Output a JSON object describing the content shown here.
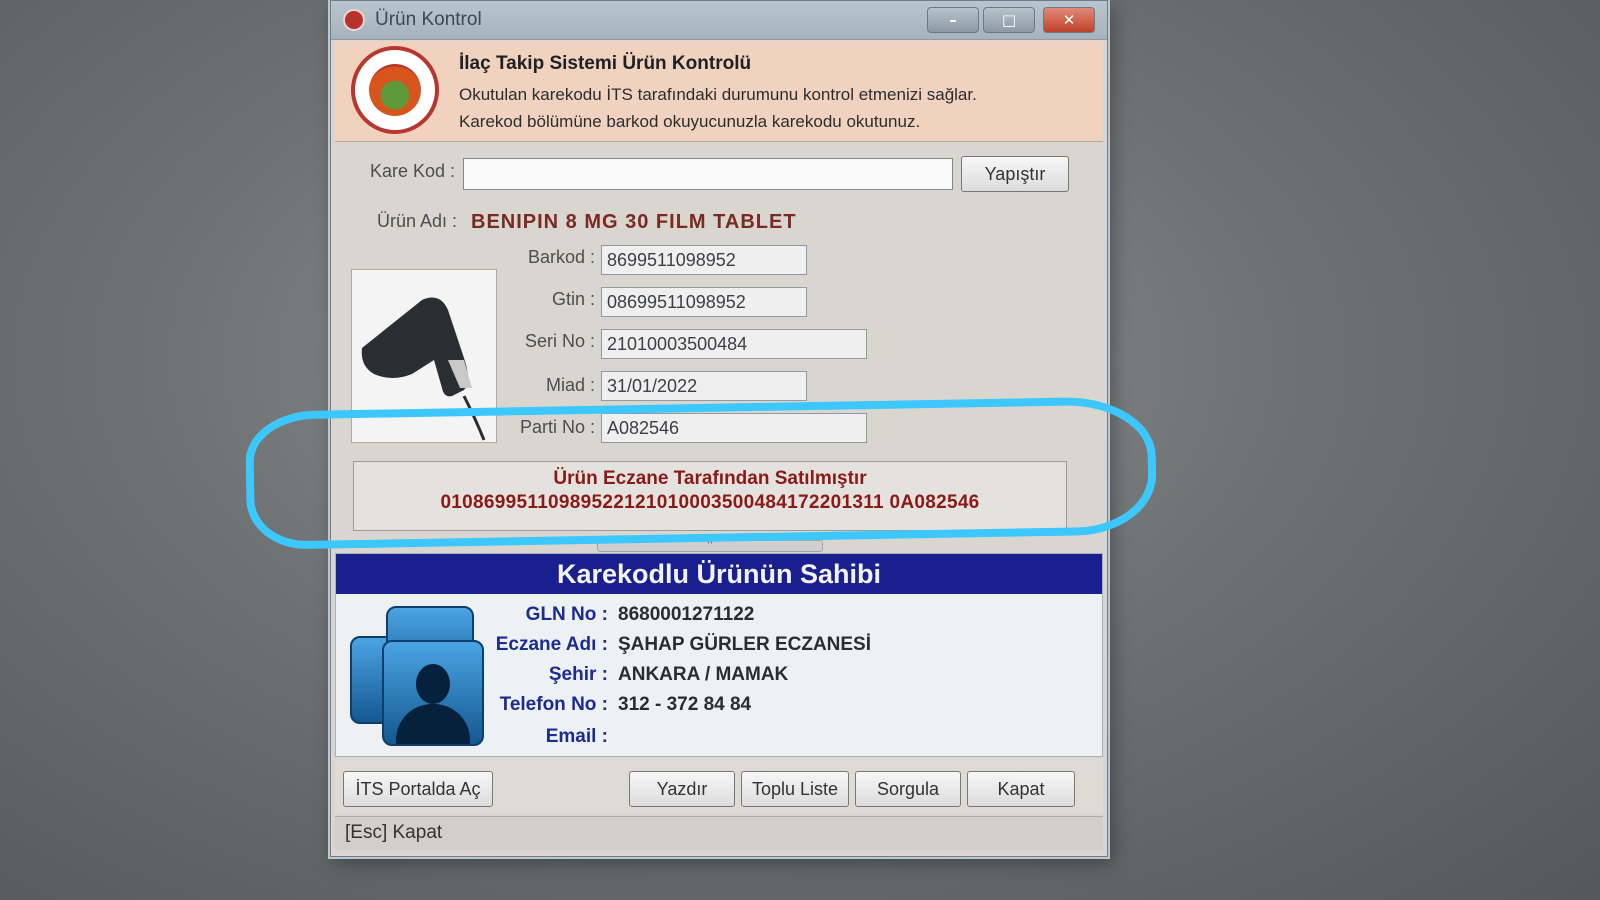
{
  "window": {
    "title": "Ürün Kontrol",
    "controls": [
      "minimize-icon",
      "maximize-icon",
      "close-icon"
    ]
  },
  "header": {
    "title": "İlaç Takip Sistemi Ürün Kontrolü",
    "line1": "Okutulan karekodu İTS tarafındaki durumunu kontrol etmenizi sağlar.",
    "line2": "Karekod bölümüne barkod okuyucunuzla karekodu okutunuz."
  },
  "form": {
    "karekod_label": "Kare Kod :",
    "karekod_value": "",
    "paste_button": "Yapıştır",
    "urun_adi_label": "Ürün Adı :",
    "urun_adi_value": "BENIPIN 8 MG 30 FILM TABLET",
    "barkod_label": "Barkod :",
    "barkod_value": "8699511098952",
    "gtin_label": "Gtin :",
    "gtin_value": "08699511098952",
    "seri_label": "Seri No :",
    "seri_value": "21010003500484",
    "miad_label": "Miad :",
    "miad_value": "31/01/2022",
    "parti_label": "Parti No :",
    "parti_value": "A082546"
  },
  "status": {
    "title": "Ürün Eczane Tarafından Satılmıştır",
    "code": "01086995110989522121010003500484172201311 0A082546"
  },
  "owner": {
    "title": "Karekodlu  Ürünün Sahibi",
    "gln_label": "GLN No :",
    "gln_value": "8680001271122",
    "eczane_label": "Eczane Adı :",
    "eczane_value": "ŞAHAP GÜRLER ECZANESİ",
    "sehir_label": "Şehir :",
    "sehir_value": "ANKARA / MAMAK",
    "telefon_label": "Telefon No :",
    "telefon_value": "312 - 372 84 84",
    "email_label": "Email :",
    "email_value": ""
  },
  "buttons": {
    "its_portal": "İTS Portalda Aç",
    "print": "Yazdır",
    "bulk_list": "Toplu Liste",
    "query": "Sorgula",
    "close": "Kapat"
  },
  "statusbar": {
    "text": "[Esc] Kapat"
  },
  "colors": {
    "owner_title_bg": "#191f8e",
    "status_text": "#8b1a16",
    "highlight": "#3cc7ff",
    "header_bg": "#f1d2bf"
  }
}
